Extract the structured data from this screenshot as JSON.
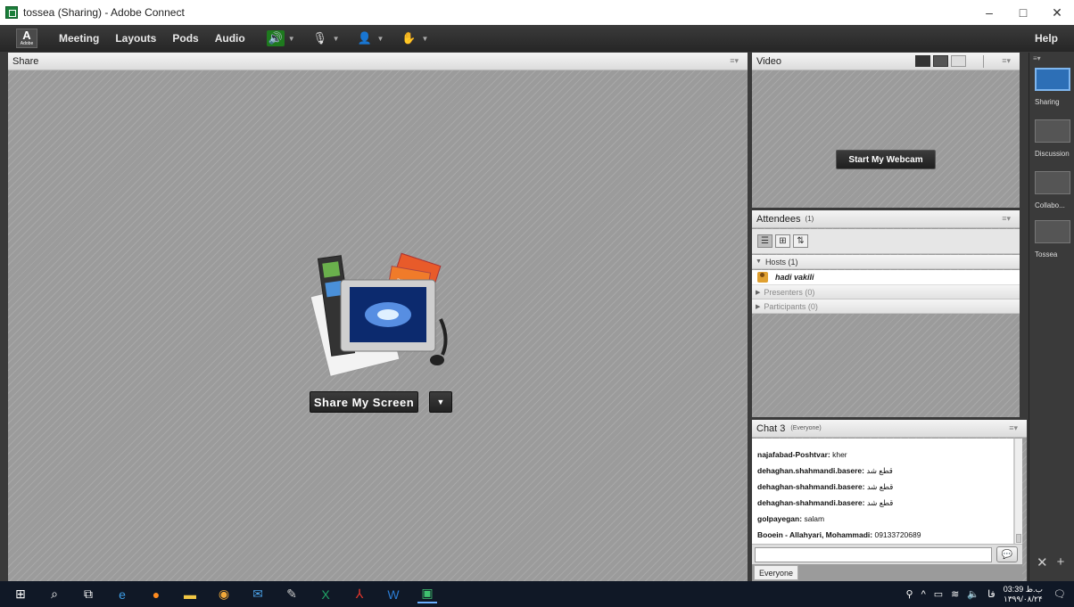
{
  "window": {
    "title": "tossea (Sharing) - Adobe Connect",
    "controls": [
      "–",
      "□",
      "✕"
    ]
  },
  "menubar": {
    "logo_letter": "A",
    "logo_text": "Adobe",
    "items": [
      "Meeting",
      "Layouts",
      "Pods",
      "Audio"
    ],
    "help": "Help"
  },
  "share": {
    "title": "Share",
    "button": "Share My Screen",
    "dropdown": "▼"
  },
  "video": {
    "title": "Video",
    "button": "Start My Webcam"
  },
  "attendees": {
    "title": "Attendees",
    "count": "(1)",
    "groups": {
      "hosts": "Hosts (1)",
      "presenters": "Presenters (0)",
      "participants": "Participants (0)"
    },
    "host_name": "hadi vakili"
  },
  "chat": {
    "title": "Chat 3",
    "scope": "(Everyone)",
    "messages": [
      {
        "sender": "najafabad-Poshtvar:",
        "text": "kher"
      },
      {
        "sender": "dehaghan.shahmandi.basere:",
        "text": "قطع شد"
      },
      {
        "sender": "dehaghan-shahmandi.basere:",
        "text": "قطع شد"
      },
      {
        "sender": "dehaghan-shahmandi.basere:",
        "text": "قطع شد"
      },
      {
        "sender": "golpayegan:",
        "text": "salam"
      },
      {
        "sender": "Booein - Allahyari, Mohammadi:",
        "text": "09133720689"
      }
    ],
    "input_value": "",
    "tab": "Everyone"
  },
  "layouts": {
    "items": [
      "Sharing",
      "Discussion",
      "Collabo...",
      "Tossea"
    ],
    "selected": "Sharing"
  },
  "taskbar": {
    "clock_time": "03:39 ب.ظ",
    "clock_date": "۱۳۹۹/۰۸/۲۴",
    "lang": "فا"
  },
  "colors": {
    "accent": "#2d6fb6",
    "audio_on": "#1e7a1e",
    "taskbar": "#101826"
  }
}
